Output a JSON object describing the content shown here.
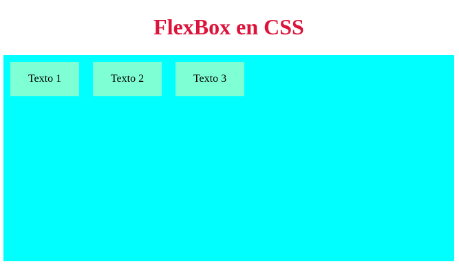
{
  "page": {
    "title": "FlexBox en CSS"
  },
  "flex_container": {
    "items": [
      {
        "label": "Texto 1"
      },
      {
        "label": "Texto 2"
      },
      {
        "label": "Texto 3"
      }
    ]
  },
  "colors": {
    "title": "#dc143c",
    "container_background": "#00ffff",
    "item_background": "#7fffd4"
  }
}
